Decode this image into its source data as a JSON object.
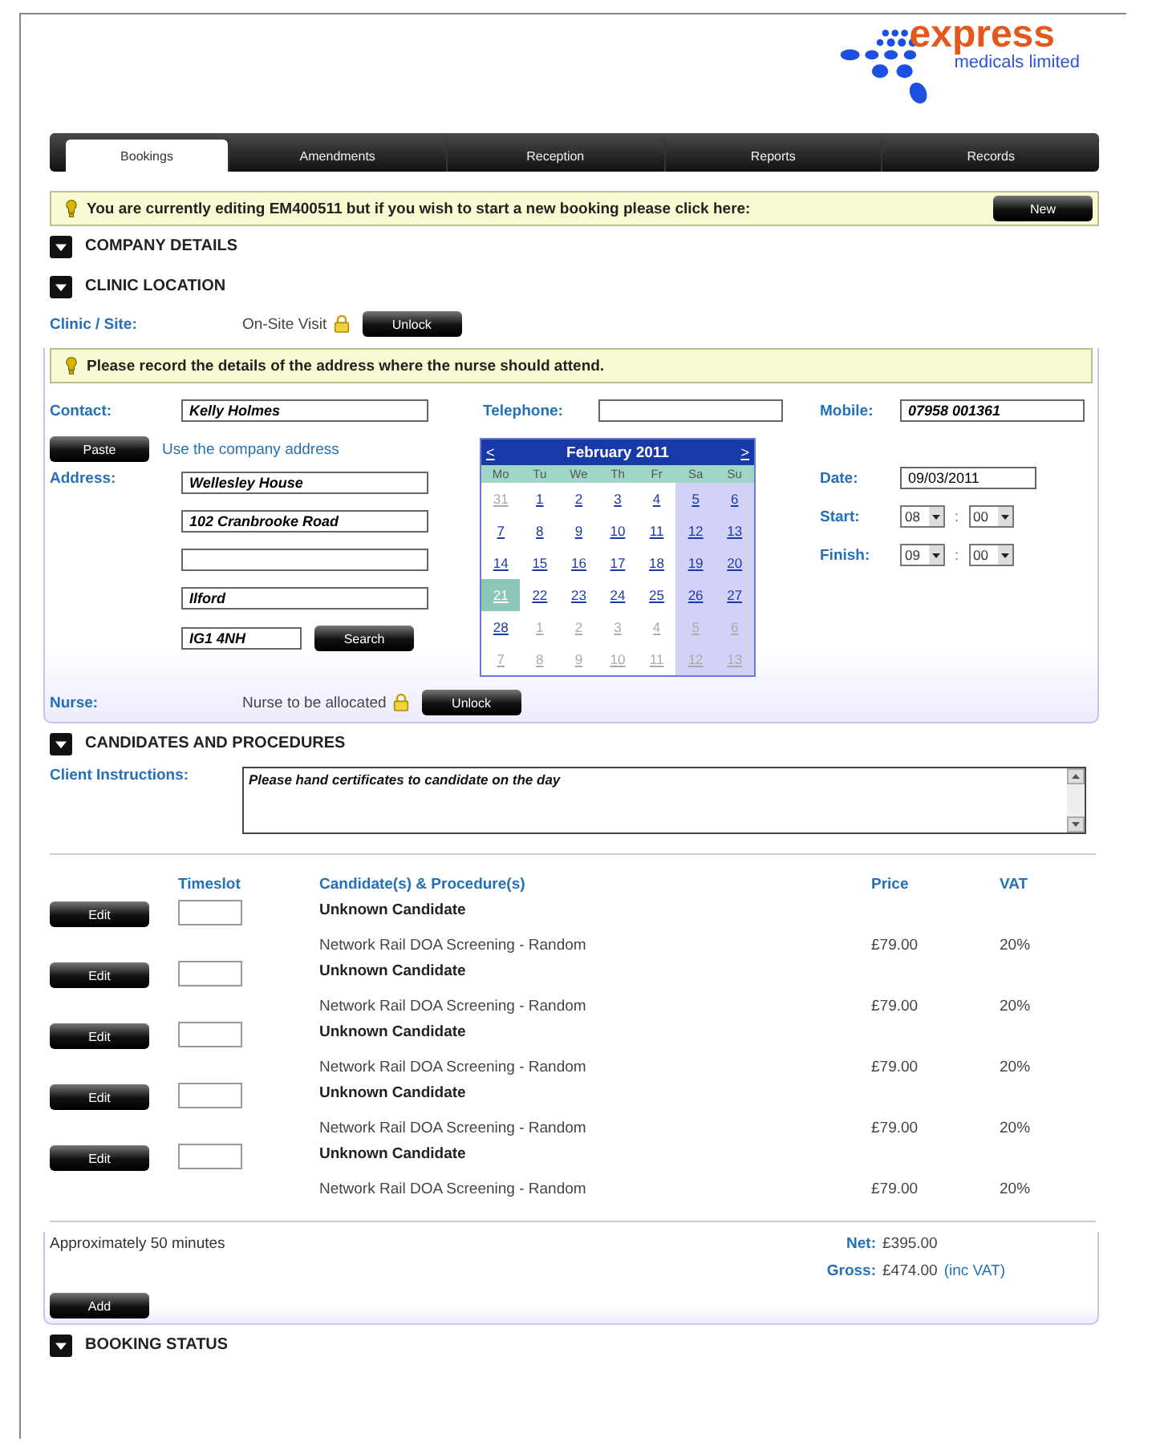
{
  "logo": {
    "name": "express",
    "tagline": "medicals limited"
  },
  "tabs": [
    {
      "label": "Bookings",
      "selected": true
    },
    {
      "label": "Amendments",
      "selected": false
    },
    {
      "label": "Reception",
      "selected": false
    },
    {
      "label": "Reports",
      "selected": false
    },
    {
      "label": "Records",
      "selected": false
    }
  ],
  "editing_notice": {
    "text": "You are currently editing EM400511 but if you wish to start a new booking please click here:",
    "button": "New"
  },
  "sections_top": [
    {
      "title": "COMPANY DETAILS"
    },
    {
      "title": "CLINIC LOCATION"
    }
  ],
  "clinic": {
    "label": "Clinic / Site:",
    "value": "On-Site Visit",
    "button": "Unlock"
  },
  "address_notice": {
    "text": "Please record the details of the address where the nurse should attend."
  },
  "contact": {
    "label": "Contact:",
    "value": "Kelly Holmes"
  },
  "telephone": {
    "label": "Telephone:"
  },
  "mobile": {
    "label": "Mobile:",
    "value": "07958 001361"
  },
  "paste": {
    "button": "Paste",
    "link": "Use the company address"
  },
  "address": {
    "label": "Address:",
    "lines": [
      {
        "kind": "text",
        "value": "Wellesley House"
      },
      {
        "kind": "text",
        "value": "102 Cranbrooke Road"
      },
      {
        "kind": "blank"
      },
      {
        "kind": "text",
        "value": "Ilford"
      }
    ],
    "postcode": "IG1 4NH",
    "button": "Search"
  },
  "calendar": {
    "prev": "<",
    "title": "February 2011",
    "next": ">",
    "weekdays": [
      "Mo",
      "Tu",
      "We",
      "Th",
      "Fr",
      "Sa",
      "Su"
    ],
    "weeks": [
      [
        {
          "day": "31",
          "muted": true,
          "selected": false
        },
        {
          "day": "1",
          "muted": false,
          "selected": false
        },
        {
          "day": "2",
          "muted": false,
          "selected": false
        },
        {
          "day": "3",
          "muted": false,
          "selected": false
        },
        {
          "day": "4",
          "muted": false,
          "selected": false
        },
        {
          "day": "5",
          "muted": false,
          "selected": false
        },
        {
          "day": "6",
          "muted": false,
          "selected": false
        }
      ],
      [
        {
          "day": "7",
          "muted": false,
          "selected": false
        },
        {
          "day": "8",
          "muted": false,
          "selected": false
        },
        {
          "day": "9",
          "muted": false,
          "selected": false
        },
        {
          "day": "10",
          "muted": false,
          "selected": false
        },
        {
          "day": "11",
          "muted": false,
          "selected": false
        },
        {
          "day": "12",
          "muted": false,
          "selected": false
        },
        {
          "day": "13",
          "muted": false,
          "selected": false
        }
      ],
      [
        {
          "day": "14",
          "muted": false,
          "selected": false
        },
        {
          "day": "15",
          "muted": false,
          "selected": false
        },
        {
          "day": "16",
          "muted": false,
          "selected": false
        },
        {
          "day": "17",
          "muted": false,
          "selected": false
        },
        {
          "day": "18",
          "muted": false,
          "selected": false
        },
        {
          "day": "19",
          "muted": false,
          "selected": false
        },
        {
          "day": "20",
          "muted": false,
          "selected": false
        }
      ],
      [
        {
          "day": "21",
          "muted": false,
          "selected": true
        },
        {
          "day": "22",
          "muted": false,
          "selected": false
        },
        {
          "day": "23",
          "muted": false,
          "selected": false
        },
        {
          "day": "24",
          "muted": false,
          "selected": false
        },
        {
          "day": "25",
          "muted": false,
          "selected": false
        },
        {
          "day": "26",
          "muted": false,
          "selected": false
        },
        {
          "day": "27",
          "muted": false,
          "selected": false
        }
      ],
      [
        {
          "day": "28",
          "muted": false,
          "selected": false
        },
        {
          "day": "1",
          "muted": true,
          "selected": false
        },
        {
          "day": "2",
          "muted": true,
          "selected": false
        },
        {
          "day": "3",
          "muted": true,
          "selected": false
        },
        {
          "day": "4",
          "muted": true,
          "selected": false
        },
        {
          "day": "5",
          "muted": true,
          "selected": false
        },
        {
          "day": "6",
          "muted": true,
          "selected": false
        }
      ],
      [
        {
          "day": "7",
          "muted": true,
          "selected": false
        },
        {
          "day": "8",
          "muted": true,
          "selected": false
        },
        {
          "day": "9",
          "muted": true,
          "selected": false
        },
        {
          "day": "10",
          "muted": true,
          "selected": false
        },
        {
          "day": "11",
          "muted": true,
          "selected": false
        },
        {
          "day": "12",
          "muted": true,
          "selected": false
        },
        {
          "day": "13",
          "muted": true,
          "selected": false
        }
      ]
    ]
  },
  "date": {
    "label": "Date:",
    "value": "09/03/2011"
  },
  "times": [
    {
      "label": "Start:",
      "hour": "08",
      "separator": ":",
      "minute": "00"
    },
    {
      "label": "Finish:",
      "hour": "09",
      "separator": ":",
      "minute": "00"
    }
  ],
  "nurse": {
    "label": "Nurse:",
    "value": "Nurse to be allocated",
    "button": "Unlock"
  },
  "candidates_section": {
    "title": "CANDIDATES AND PROCEDURES"
  },
  "client_instructions": {
    "label": "Client Instructions:",
    "value": "Please hand certificates to candidate on the day"
  },
  "table": {
    "columns": [
      "Timeslot",
      "Candidate(s) & Procedure(s)",
      "Price",
      "VAT"
    ],
    "rows": [
      {
        "button": "Edit",
        "candidate": "Unknown Candidate",
        "procedure": "Network Rail DOA Screening - Random",
        "price": "£79.00",
        "vat": "20%"
      },
      {
        "button": "Edit",
        "candidate": "Unknown Candidate",
        "procedure": "Network Rail DOA Screening - Random",
        "price": "£79.00",
        "vat": "20%"
      },
      {
        "button": "Edit",
        "candidate": "Unknown Candidate",
        "procedure": "Network Rail DOA Screening - Random",
        "price": "£79.00",
        "vat": "20%"
      },
      {
        "button": "Edit",
        "candidate": "Unknown Candidate",
        "procedure": "Network Rail DOA Screening - Random",
        "price": "£79.00",
        "vat": "20%"
      },
      {
        "button": "Edit",
        "candidate": "Unknown Candidate",
        "procedure": "Network Rail DOA Screening - Random",
        "price": "£79.00",
        "vat": "20%"
      }
    ]
  },
  "totals": {
    "duration": "Approximately 50 minutes",
    "net_label": "Net:",
    "net": "£395.00",
    "gross_label": "Gross:",
    "gross": "£474.00",
    "gross_note": "(inc VAT)"
  },
  "add_button": "Add",
  "sections_bottom": [
    {
      "title": "BOOKING STATUS"
    }
  ]
}
